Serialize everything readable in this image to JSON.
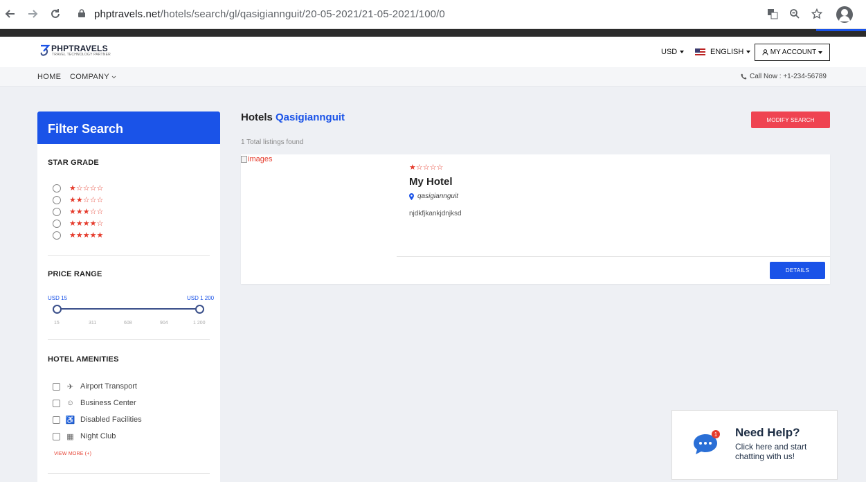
{
  "browser": {
    "url_host": "phptravels.net",
    "url_path": "/hotels/search/gl/qasigiannguit/20-05-2021/21-05-2021/100/0"
  },
  "header": {
    "logo_name": "PHPTRAVELS",
    "logo_tagline": "TRAVEL TECHNOLOGY PARTNER",
    "currency": "USD",
    "language": "ENGLISH",
    "account": "MY ACCOUNT"
  },
  "subnav": {
    "home": "HOME",
    "company": "COMPANY",
    "phone": "Call Now : +1-234-56789"
  },
  "filter": {
    "title": "Filter Search",
    "star_grade_title": "STAR GRADE",
    "star_options": [
      {
        "stars": "★☆☆☆☆"
      },
      {
        "stars": "★★☆☆☆"
      },
      {
        "stars": "★★★☆☆"
      },
      {
        "stars": "★★★★☆"
      },
      {
        "stars": "★★★★★"
      }
    ],
    "price_range_title": "PRICE RANGE",
    "price_min_label": "USD 15",
    "price_max_label": "USD 1 200",
    "price_ticks": [
      "15",
      "311",
      "608",
      "904",
      "1 200"
    ],
    "amenities_title": "HOTEL AMENITIES",
    "amenities": [
      {
        "label": "Airport Transport",
        "icon": "airplane-icon"
      },
      {
        "label": "Business Center",
        "icon": "business-center-icon"
      },
      {
        "label": "Disabled Facilities",
        "icon": "wheelchair-icon"
      },
      {
        "label": "Night Club",
        "icon": "night-club-icon"
      }
    ],
    "view_more": "VIEW MORE (+)"
  },
  "main": {
    "title_prefix": "Hotels",
    "title_city": "Qasigiannguit",
    "modify_search": "MODIFY SEARCH",
    "listing_count": "1 Total listings found"
  },
  "hotel": {
    "image_alt": "images",
    "stars": "★☆☆☆☆",
    "name": "My Hotel",
    "location": "qasigiannguit",
    "description": "njdkfjkankjdnjksd",
    "details_button": "DETAILS"
  },
  "help": {
    "badge": "1",
    "title": "Need Help?",
    "subtitle": "Click here and start chatting with us!"
  },
  "colors": {
    "primary": "#1a53e8",
    "danger": "#ef4351",
    "star": "#e53b2c"
  }
}
